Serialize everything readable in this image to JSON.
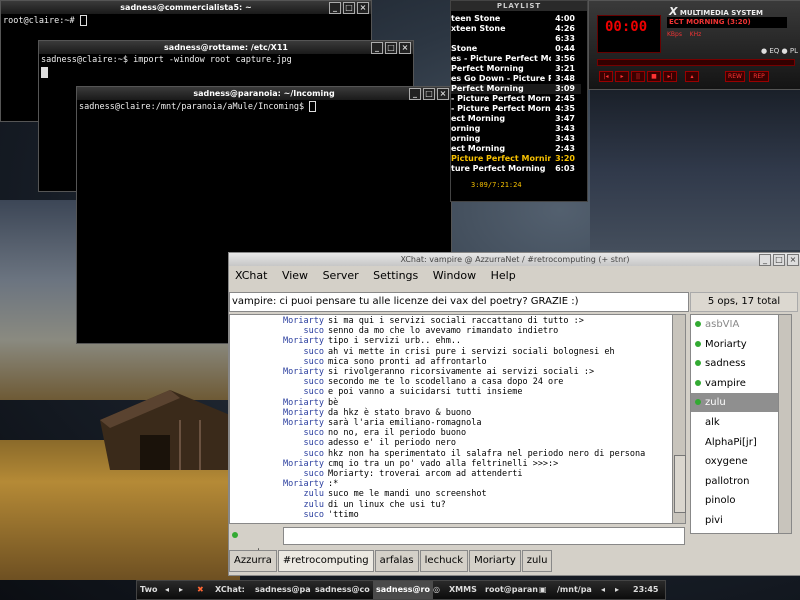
{
  "terminals": {
    "t1": {
      "title": "sadness@commercialista5: ~",
      "lines": [
        "root@claire:~# "
      ]
    },
    "t2": {
      "title": "sadness@rottame: /etc/X11",
      "lines": [
        "sadness@claire:~$ import -window root capture.jpg"
      ]
    },
    "t3": {
      "title": "sadness@paranoia: ~/Incoming",
      "lines": [
        "sadness@claire:/mnt/paranoia/aMule/Incoming$ "
      ]
    }
  },
  "playlist": {
    "title": "PLAYLIST",
    "rows": [
      {
        "t": "teen Stone",
        "d": "4:00"
      },
      {
        "t": "xteen Stone",
        "d": "4:26"
      },
      {
        "t": "",
        "d": "6:33"
      },
      {
        "t": "Stone",
        "d": "0:44"
      },
      {
        "t": "es - Picture Perfect Morning",
        "d": "3:56"
      },
      {
        "t": "Perfect Morning",
        "d": "3:21"
      },
      {
        "t": "es Go Down - Picture Perfect Mor",
        "d": "3:48"
      },
      {
        "t": "Perfect Morning",
        "d": "3:09"
      },
      {
        "t": "- Picture Perfect Morning",
        "d": "2:45"
      },
      {
        "t": "- Picture Perfect Morning",
        "d": "4:35"
      },
      {
        "t": "ect Morning",
        "d": "3:47"
      },
      {
        "t": "orning",
        "d": "3:43"
      },
      {
        "t": "orning",
        "d": "3:43"
      },
      {
        "t": "ect Morning",
        "d": "2:43"
      },
      {
        "t": "Picture Perfect Morning",
        "d": "3:20"
      },
      {
        "t": "ture Perfect Morning",
        "d": "6:03"
      }
    ],
    "status": "3:09/7:21:24",
    "current_index": 14
  },
  "xmms": {
    "title": "MULTIMEDIA SYSTEM",
    "time": "00:00",
    "song": "ECT MORNING (3:20)",
    "kbps": "KBps",
    "khz": "KHz",
    "eq": "EQ",
    "pl": "PL",
    "rew": "REW",
    "rep": "REP"
  },
  "xchat": {
    "title": "XChat: vampire @ AzzurraNet / #retrocomputing (+ stnr)",
    "menu": [
      "XChat",
      "View",
      "Server",
      "Settings",
      "Window",
      "Help"
    ],
    "topic": "vampire: ci puoi pensare tu alle licenze dei vax del poetry? GRAZIE :)",
    "user_count": "5 ops, 17 total",
    "messages": [
      {
        "n": "Moriarty",
        "x": "si ma qui i servizi sociali raccattano di tutto :>"
      },
      {
        "n": "suco",
        "x": "senno da mo che lo avevamo rimandato indietro"
      },
      {
        "n": "Moriarty",
        "x": "tipo i servizi urb.. ehm.."
      },
      {
        "n": "suco",
        "x": "ah vi mette in crisi pure i servizi sociali bolognesi eh"
      },
      {
        "n": "suco",
        "x": "mica sono pronti ad affrontarlo"
      },
      {
        "n": "Moriarty",
        "x": "si rivolgeranno ricorsivamente ai servizi sociali :>"
      },
      {
        "n": "suco",
        "x": "secondo me te lo scodellano a casa dopo 24 ore"
      },
      {
        "n": "suco",
        "x": "e poi vanno a suicidarsi tutti insieme"
      },
      {
        "n": "Moriarty",
        "x": "bè"
      },
      {
        "n": "Moriarty",
        "x": "da hkz è stato bravo & buono"
      },
      {
        "n": "Moriarty",
        "x": "sarà l'aria emiliano-romagnola"
      },
      {
        "n": "suco",
        "x": "no no, era il periodo buono"
      },
      {
        "n": "suco",
        "x": "adesso e' il periodo nero"
      },
      {
        "n": "suco",
        "x": "hkz non ha sperimentato il salafra nel periodo nero di persona"
      },
      {
        "n": "Moriarty",
        "x": "cmq io tra un po' vado alla feltrinelli >>>:>"
      },
      {
        "n": "suco",
        "x": "Moriarty: troverai arcom ad attenderti"
      },
      {
        "n": "Moriarty",
        "x": ":*"
      },
      {
        "n": "zulu",
        "x": "suco me le mandi uno screenshot"
      },
      {
        "n": "zulu",
        "x": "di un linux che usi tu?"
      },
      {
        "n": "suco",
        "x": "'ttimo"
      }
    ],
    "users": [
      {
        "name": "asbVIA",
        "away": true
      },
      {
        "name": "Moriarty"
      },
      {
        "name": "sadness"
      },
      {
        "name": "vampire"
      },
      {
        "name": "zulu",
        "selected": true
      },
      {
        "name": "alk",
        "nodot": true
      },
      {
        "name": "AlphaPi[jr]",
        "nodot": true
      },
      {
        "name": "oxygene",
        "nodot": true
      },
      {
        "name": "pallotron",
        "nodot": true
      },
      {
        "name": "pinolo",
        "nodot": true
      },
      {
        "name": "pivi",
        "nodot": true
      }
    ],
    "nick": "vampire",
    "input_value": "",
    "tabs": [
      "Azzurra",
      "#retrocomputing",
      "arfalas",
      "lechuck",
      "Moriarty",
      "zulu"
    ],
    "active_tab": 1
  },
  "taskbar": {
    "desk": "Two",
    "items": [
      "XChat:",
      "sadness@pa",
      "sadness@co",
      "sadness@ro",
      "XMMS",
      "root@paran",
      "/mnt/pa"
    ],
    "clock": "23:45"
  },
  "colors": {
    "nick": "#2a3e9e",
    "selected_user": "#8f8f8f",
    "xmms_red": "#e03030",
    "playlist_current": "#f6c000"
  }
}
